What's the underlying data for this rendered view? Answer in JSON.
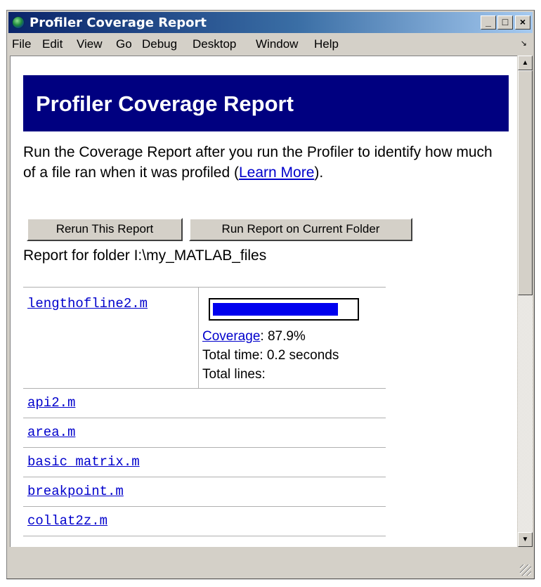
{
  "window": {
    "title": "Profiler Coverage Report",
    "minimize_glyph": "_",
    "maximize_glyph": "□",
    "close_glyph": "×",
    "icon": "matlab-globe-icon"
  },
  "menubar": {
    "items": [
      "File",
      "Edit",
      "View",
      "Go",
      "Debug",
      "Desktop",
      "Window",
      "Help"
    ],
    "dock_arrow": "↘"
  },
  "report": {
    "heading": "Profiler Coverage Report",
    "intro_text": "Run the Coverage Report after you run the Profiler to identify how much of a file ran when it was profiled (",
    "learn_more_link": "Learn More",
    "intro_end": ").",
    "rerun_button": "Rerun This Report",
    "run_folder_button": "Run Report on Current Folder",
    "folder_line": "Report for folder I:\\my_MATLAB_files"
  },
  "first_file": {
    "name": "lengthofline2.m",
    "coverage_link": "Coverage",
    "coverage_value": ": 87.9%",
    "coverage_fraction": 0.879,
    "total_time": "Total time: 0.2 seconds",
    "total_lines": "Total lines:"
  },
  "files": [
    "api2.m",
    "area.m",
    "basic matrix.m",
    "breakpoint.m",
    "collat2z.m"
  ],
  "colors": {
    "banner": "#000080",
    "link": "#0000cc",
    "coverage_bar": "#0000ee"
  }
}
